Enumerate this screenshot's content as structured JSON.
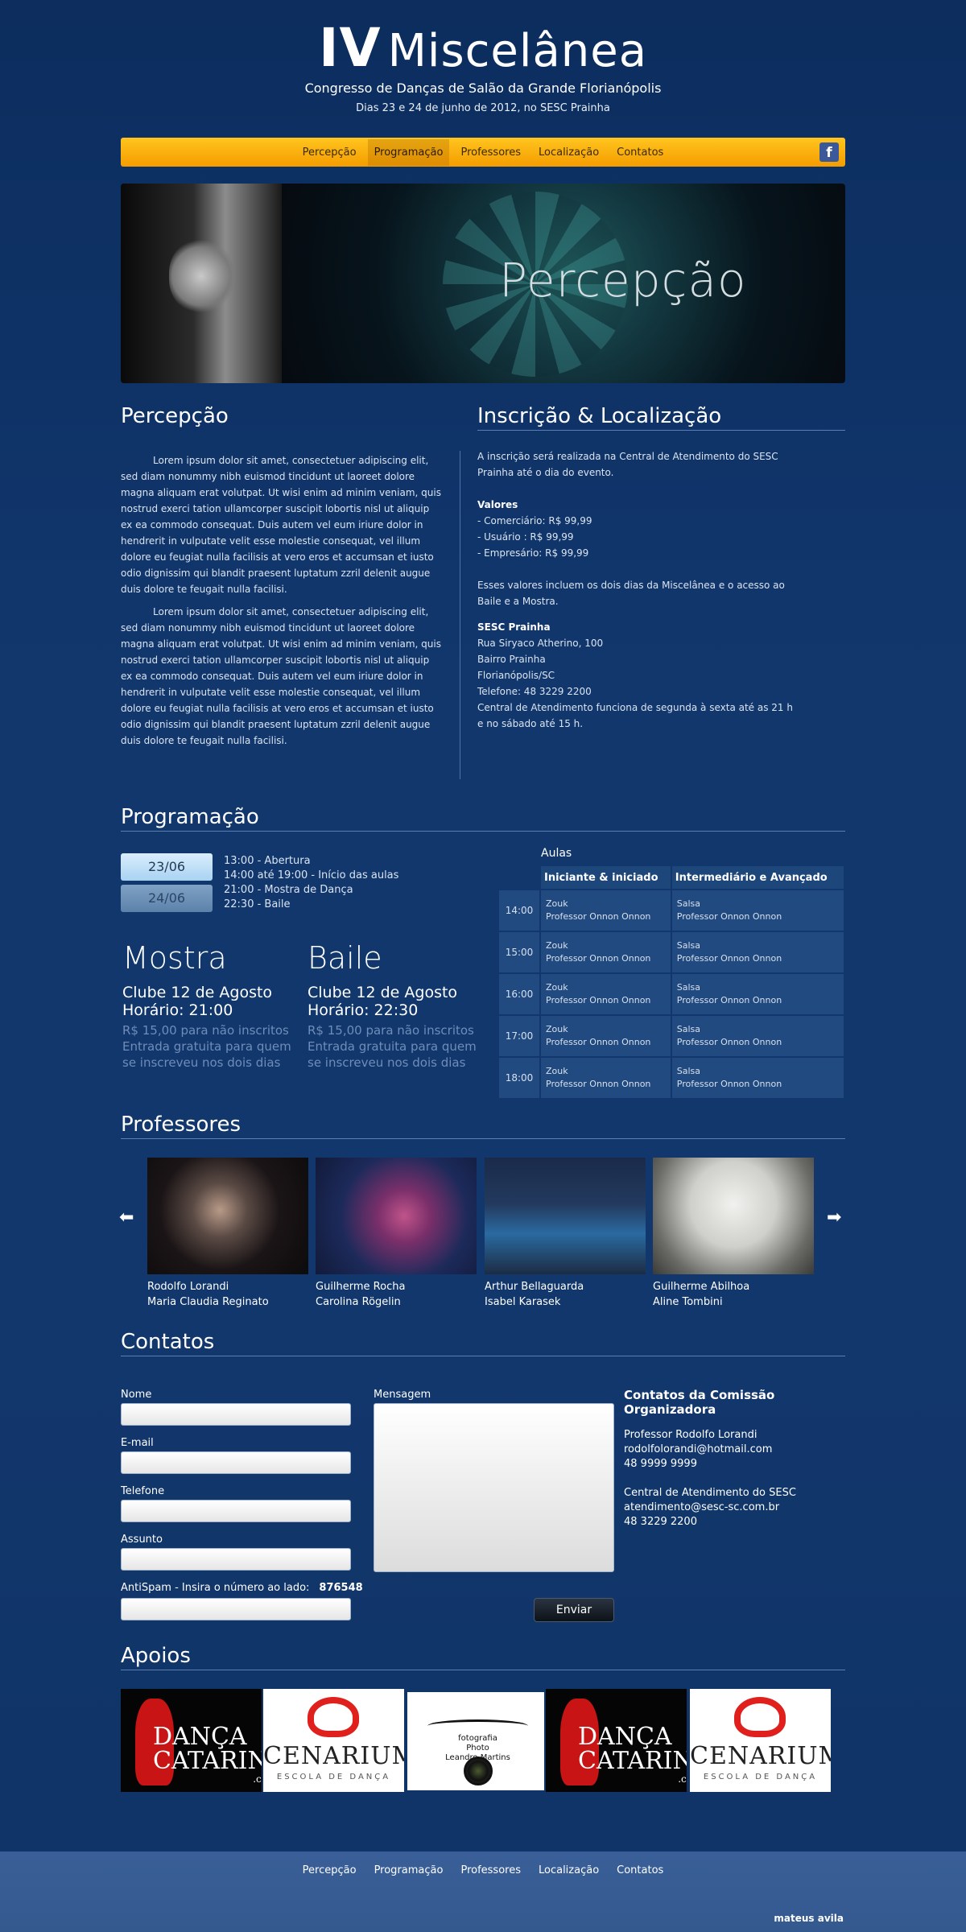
{
  "header": {
    "title_roman": "IV",
    "title_word": "Miscelânea",
    "subtitle": "Congresso de Danças de Salão da Grande Florianópolis",
    "dates": "Dias 23 e 24 de junho de 2012, no SESC Prainha"
  },
  "nav": {
    "items": [
      "Percepção",
      "Programação",
      "Professores",
      "Localização",
      "Contatos"
    ],
    "active": "Programação",
    "facebook_icon": "facebook-icon"
  },
  "banner": {
    "title": "Percepção"
  },
  "percepcao": {
    "heading": "Percepção",
    "paragraphs": [
      "Lorem ipsum dolor sit amet, consectetuer adipiscing elit, sed diam nonummy nibh euismod tincidunt ut laoreet dolore magna aliquam erat volutpat. Ut wisi enim ad minim veniam, quis nostrud exerci tation ullamcorper suscipit lobortis nisl ut aliquip ex ea commodo consequat. Duis autem vel eum iriure dolor in hendrerit in vulputate velit esse molestie consequat, vel illum dolore eu feugiat nulla facilisis at vero eros et accumsan et iusto odio dignissim qui blandit praesent luptatum zzril delenit augue duis dolore te feugait nulla facilisi.",
      "Lorem ipsum dolor sit amet, consectetuer adipiscing elit, sed diam nonummy nibh euismod tincidunt ut laoreet dolore magna aliquam erat volutpat. Ut wisi enim ad minim veniam, quis nostrud exerci tation ullamcorper suscipit lobortis nisl ut aliquip ex ea commodo consequat. Duis autem vel eum iriure dolor in hendrerit in vulputate velit esse molestie consequat, vel illum dolore eu feugiat nulla facilisis at vero eros et accumsan et iusto odio dignissim qui blandit praesent luptatum zzril delenit augue duis dolore te feugait nulla facilisi."
    ]
  },
  "inscricao": {
    "heading": "Inscrição & Localização",
    "intro": "A inscrição será realizada na Central de Atendimento do SESC Prainha até o dia do evento.",
    "valores_title": "Valores",
    "valores": [
      "- Comerciário: R$ 99,99",
      "- Usuário : R$ 99,99",
      "- Empresário: R$ 99,99"
    ],
    "valores_note": "Esses valores incluem os dois dias da Miscelânea e o acesso ao Baile e a Mostra.",
    "local_title": "SESC Prainha",
    "local_lines": [
      "Rua Siryaco Atherino, 100",
      "Bairro Prainha",
      "Florianópolis/SC",
      "Telefone: 48 3229 2200",
      "Central de Atendimento funciona de segunda à sexta até as 21 h e no sábado até 15 h."
    ]
  },
  "programacao": {
    "heading": "Programação",
    "dates": [
      "23/06",
      "24/06"
    ],
    "schedule": [
      "13:00 - Abertura",
      "14:00 até 19:00 - Início das aulas",
      "21:00 - Mostra de Dança",
      "22:30 - Baile"
    ],
    "events": [
      {
        "title": "Mostra",
        "place": "Clube 12 de Agosto",
        "time": "Horário: 21:00",
        "price": "R$ 15,00 para não inscritos",
        "note": "Entrada gratuita para quem se inscreveu nos dois dias"
      },
      {
        "title": "Baile",
        "place": "Clube 12 de Agosto",
        "time": "Horário: 22:30",
        "price": "R$ 15,00 para não inscritos",
        "note": "Entrada gratuita para quem se inscreveu nos dois dias"
      }
    ],
    "aulas": {
      "caption": "Aulas",
      "columns": [
        "Iniciante & iniciado",
        "Intermediário e Avançado"
      ],
      "rows": [
        {
          "time": "14:00",
          "a1": "Zouk",
          "p1": "Professor Onnon Onnon",
          "a2": "Salsa",
          "p2": "Professor Onnon Onnon"
        },
        {
          "time": "15:00",
          "a1": "Zouk",
          "p1": "Professor Onnon Onnon",
          "a2": "Salsa",
          "p2": "Professor Onnon Onnon"
        },
        {
          "time": "16:00",
          "a1": "Zouk",
          "p1": "Professor Onnon Onnon",
          "a2": "Salsa",
          "p2": "Professor Onnon Onnon"
        },
        {
          "time": "17:00",
          "a1": "Zouk",
          "p1": "Professor Onnon Onnon",
          "a2": "Salsa",
          "p2": "Professor Onnon Onnon"
        },
        {
          "time": "18:00",
          "a1": "Zouk",
          "p1": "Professor Onnon Onnon",
          "a2": "Salsa",
          "p2": "Professor Onnon Onnon"
        }
      ]
    }
  },
  "professores": {
    "heading": "Professores",
    "cards": [
      {
        "line1": "Rodolfo Lorandi",
        "line2": "Maria Claudia Reginato"
      },
      {
        "line1": "Guilherme Rocha",
        "line2": "Carolina Rögelin"
      },
      {
        "line1": "Arthur Bellaguarda",
        "line2": "Isabel Karasek"
      },
      {
        "line1": "Guilherme Abilhoa",
        "line2": "Aline Tombini"
      }
    ]
  },
  "contatos": {
    "heading": "Contatos",
    "fields": [
      "Nome",
      "E-mail",
      "Telefone",
      "Assunto"
    ],
    "antispam_label": "AntiSpam - Insira o número ao lado:",
    "antispam_code": "876548",
    "message_label": "Mensagem",
    "send_label": "Enviar",
    "org_title": "Contatos da Comissão Organizadora",
    "org_lines_1": [
      "Professor Rodolfo Lorandi",
      "rodolfolorandi@hotmail.com",
      "48 9999 9999"
    ],
    "org_lines_2": [
      "Central de Atendimento do SESC",
      "atendimento@sesc-sc.com.br",
      "48 3229 2200"
    ]
  },
  "apoios": {
    "heading": "Apoios",
    "dc_word": "DANÇA CATARINA",
    "dc_sub": ".com",
    "cen_word": "CENARIUM",
    "cen_sub": "ESCOLA DE DANÇA",
    "ph_top": "fotografia",
    "ph_lines": [
      "Photo",
      "Leandro Martins"
    ]
  },
  "footer": {
    "items": [
      "Percepção",
      "Programação",
      "Professores",
      "Localização",
      "Contatos"
    ],
    "credit": "mateus avila"
  }
}
